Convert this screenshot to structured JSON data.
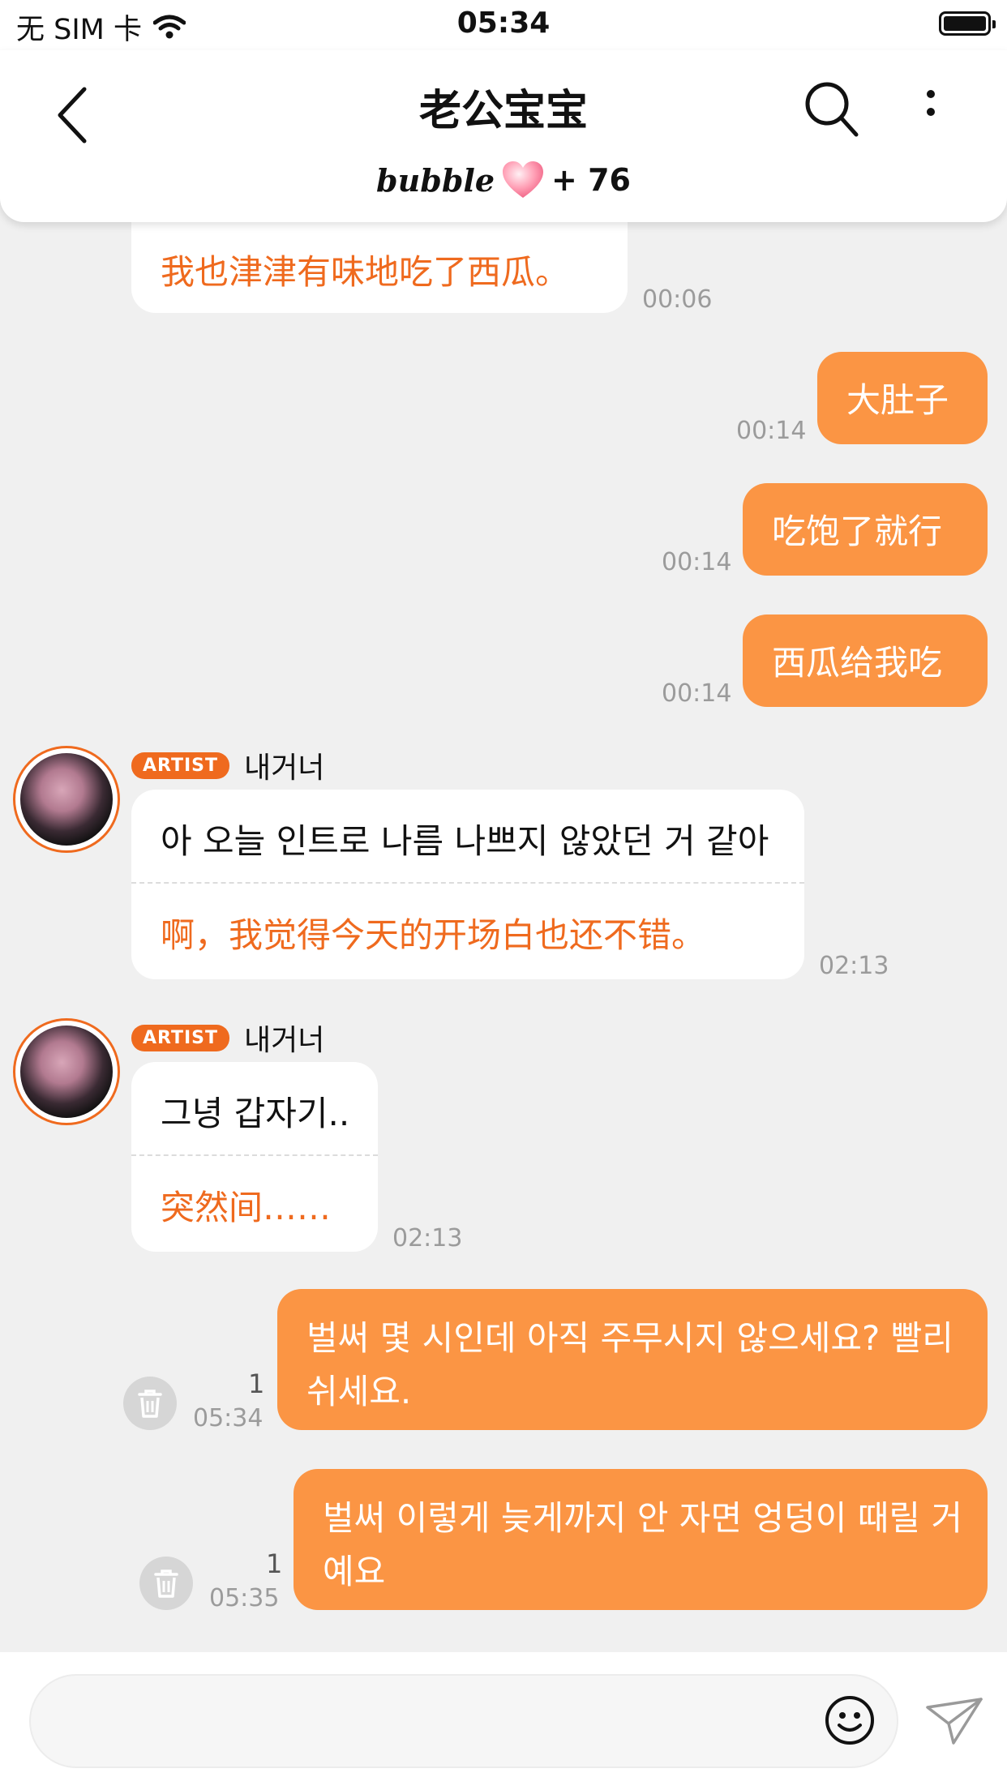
{
  "status_bar": {
    "carrier": "无 SIM 卡",
    "time": "05:34"
  },
  "header": {
    "title": "老公宝宝",
    "bubble_logo": "bubble",
    "bubble_count": "+ 76"
  },
  "messages": [
    {
      "side": "left",
      "translation": "我也津津有味地吃了西瓜。",
      "time": "00:06"
    },
    {
      "side": "right",
      "text": "大肚子",
      "time": "00:14"
    },
    {
      "side": "right",
      "text": "吃饱了就行",
      "time": "00:14"
    },
    {
      "side": "right",
      "text": "西瓜给我吃",
      "time": "00:14"
    },
    {
      "side": "left",
      "badge": "ARTIST",
      "name": "내거너",
      "text": "아 오늘 인트로 나름 나쁘지 않았던 거 같아",
      "translation": "啊，我觉得今天的开场白也还不错。",
      "time": "02:13"
    },
    {
      "side": "left",
      "badge": "ARTIST",
      "name": "내거너",
      "text": "그녕 갑자기..",
      "translation": "突然间……",
      "time": "02:13"
    },
    {
      "side": "right",
      "text_line1": "벌써 몇 시인데 아직 주무시지 않으세요? 빨리",
      "text_line2": "쉬세요.",
      "unread": "1",
      "time": "05:34"
    },
    {
      "side": "right",
      "text_line1": "벌써 이렇게 늦게까지 안 자면 엉덩이 때릴 거",
      "text_line2": "예요",
      "unread": "1",
      "time": "05:35"
    }
  ],
  "icons": {
    "back": "chevron-left-icon",
    "search": "search-icon",
    "more": "more-vertical-icon",
    "heart": "heart-icon",
    "trash": "trash-icon",
    "emoji": "emoji-icon",
    "send": "send-icon"
  },
  "colors": {
    "accent": "#ef6a1e",
    "outgoing_bubble": "#fb9544",
    "background": "#f0f0f0"
  }
}
